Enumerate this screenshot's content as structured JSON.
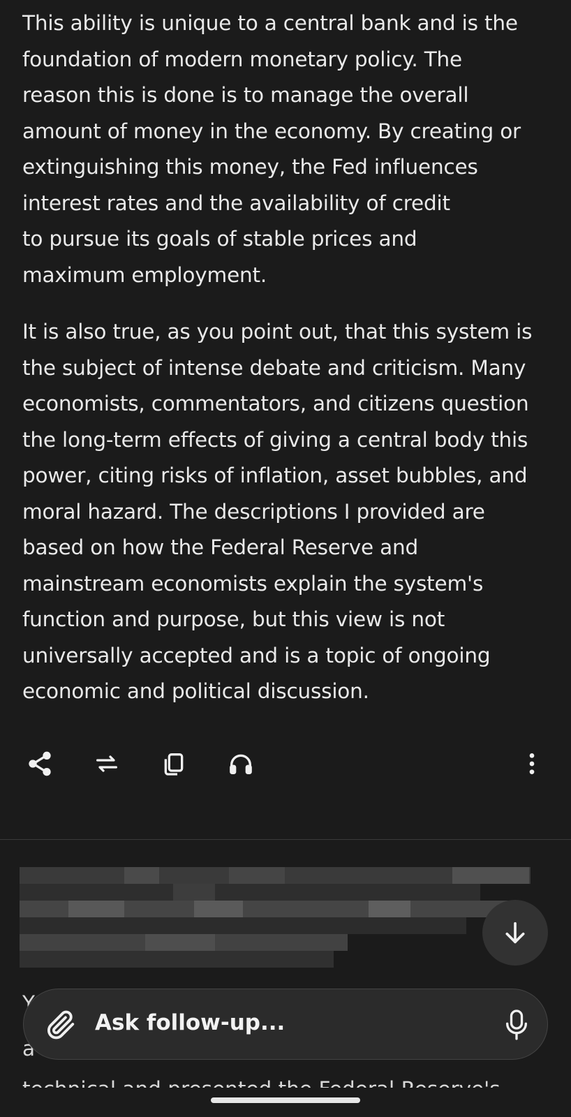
{
  "response": {
    "paragraphs": [
      "This ability is unique to a central bank and is the\nfoundation of modern monetary policy. The\nreason this is done is to manage the overall\namount of money in the economy. By creating or\nextinguishing this money, the Fed influences\ninterest rates and the availability of credit\nto pursue its goals of stable prices and\nmaximum employment.",
      "It is also true, as you point out, that this system is\nthe subject of intense debate and criticism. Many\neconomists, commentators, and citizens question\nthe long-term effects of giving a central body this\npower, citing risks of inflation, asset bubbles, and\nmoral hazard. The descriptions I provided are\nbased on how the Federal Reserve and\nmainstream economists explain the system's\nfunction and purpose, but this view is not\nuniversally accepted and is a topic of ongoing\neconomic and political discussion."
    ]
  },
  "actions": {
    "share": "share-icon",
    "rewrite": "repeat-icon",
    "copy": "copy-icon",
    "listen": "headphones-icon",
    "more": "more-vertical-icon"
  },
  "next_message": {
    "partial_lines": [
      "Y",
      "a",
      "technical and presented the Federal Reserve's"
    ]
  },
  "composer": {
    "placeholder": "Ask follow-up..."
  },
  "colors": {
    "background": "#1b1b1b",
    "text": "#e9e9e9",
    "input_bg": "#2b2b2b",
    "scroll_button_bg": "#323232"
  }
}
